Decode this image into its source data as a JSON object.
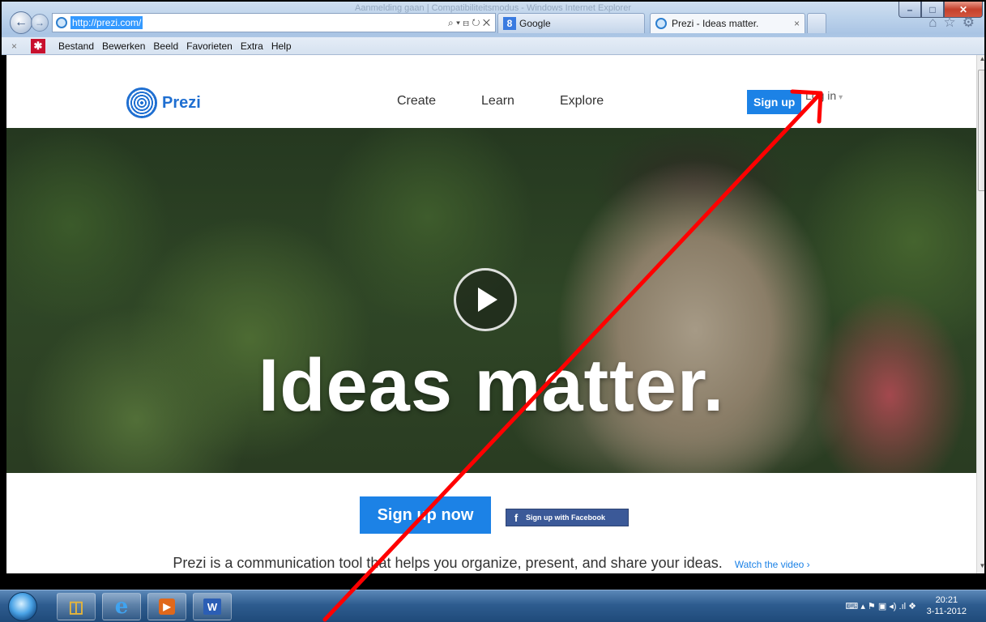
{
  "browser": {
    "caption": "Aanmelding gaan | Compatibiliteitsmodus - Windows Internet Explorer",
    "address_url": "http://prezi.com/",
    "address_tools": "⌕ ▾ ⊟ ↻ ✕",
    "tabs": [
      {
        "label": "Google"
      },
      {
        "label": "Prezi - Ideas matter."
      }
    ],
    "tab_close": "×",
    "menu_close": "×",
    "menu": [
      "Bestand",
      "Bewerken",
      "Beeld",
      "Favorieten",
      "Extra",
      "Help"
    ],
    "right_icons": {
      "home": "⌂",
      "favorites": "☆",
      "settings": "⚙"
    }
  },
  "site": {
    "logo_text": "Prezi",
    "nav": [
      "Create",
      "Learn",
      "Explore"
    ],
    "signup_top": "Sign up",
    "login": "Log in",
    "login_caret": "▾",
    "hero_headline": "Ideas matter.",
    "signup_now": "Sign up now",
    "signup_facebook": "Sign up with Facebook",
    "facebook_icon": "f",
    "tagline": "Prezi is a communication tool that helps you organize, present, and share your ideas.",
    "watch_video": "Watch the video ›"
  },
  "taskbar": {
    "apps": [
      "explorer",
      "internet-explorer",
      "media-player",
      "word"
    ],
    "tray": "⌨ ▴ ⚑ ▣ ◂) .ıl ❖",
    "time": "20:21",
    "date": "3-11-2012"
  },
  "colors": {
    "accent_blue": "#1c82e6",
    "facebook": "#3b5998",
    "annotation_arrow": "#ff0000"
  }
}
